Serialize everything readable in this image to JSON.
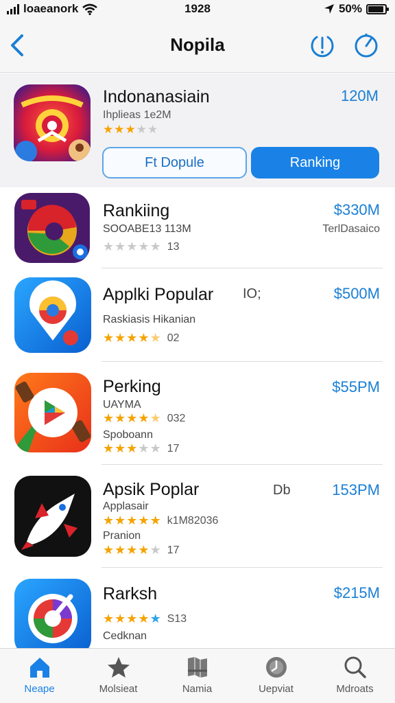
{
  "status_bar": {
    "carrier": "loaeanork",
    "time": "1928",
    "battery": "50%",
    "battery_level": 0.9
  },
  "nav": {
    "title": "Nopila"
  },
  "featured": {
    "name": "Indonanasiain",
    "subtitle": "Ihplieas 1e2M",
    "price": "120M",
    "rating": 3,
    "button_outline": "Ft Dopule",
    "button_fill": "Ranking"
  },
  "apps": [
    {
      "name": "Rankiing",
      "line1": "SOOABE13 113M",
      "rating": 0,
      "count": "13",
      "price": "$330M",
      "right_sub": "TerlDasaico",
      "mid": ""
    },
    {
      "name": "Applki Popular",
      "line1": "Raskiasis Hikanian",
      "rating": 4.5,
      "count": "02",
      "price": "$500M",
      "mid": "IO;"
    },
    {
      "name": "Perking",
      "line1": "UAYMA",
      "rating": 4.5,
      "count": "032",
      "line2": "Spoboann",
      "rating2": 3,
      "count2": "17",
      "price": "$55PM",
      "mid": ""
    },
    {
      "name": "Apsik Poplar",
      "line1": "Applasair",
      "rating": 5,
      "count": "k1M82036",
      "line2": "Pranion",
      "rating2": 4,
      "count2": "17",
      "price": "153PM",
      "mid": "Db"
    },
    {
      "name": "Rarksh",
      "rating": 5,
      "count": "S13",
      "line2": "Cedknan",
      "price": "$215M",
      "mid": ""
    }
  ],
  "tabs": [
    {
      "label": "Neape",
      "icon": "home-icon",
      "active": true
    },
    {
      "label": "Molsieat",
      "icon": "star-icon",
      "active": false
    },
    {
      "label": "Namia",
      "icon": "map-icon",
      "active": false
    },
    {
      "label": "Uepviat",
      "icon": "updates-icon",
      "active": false
    },
    {
      "label": "Mdroats",
      "icon": "search-icon",
      "active": false
    }
  ],
  "colors": {
    "accent": "#1a82e6",
    "star": "#f5a300",
    "price": "#1a7fd4"
  }
}
